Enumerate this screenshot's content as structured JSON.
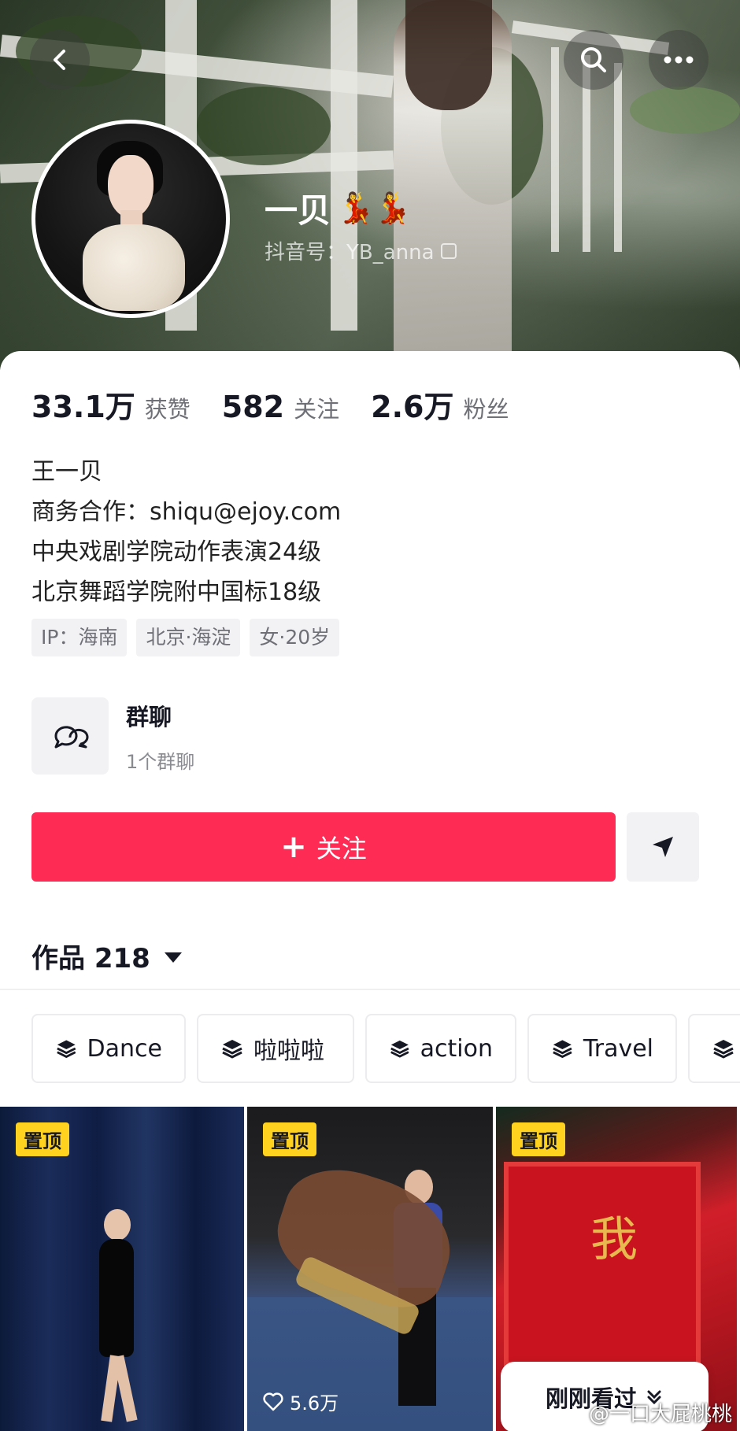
{
  "header": {
    "name": "一贝",
    "name_emoji": "💃💃",
    "handle": "抖音号：YB_anna",
    "back_icon": "chevron-left-icon",
    "search_icon": "search-icon",
    "more_icon": "more-dots-icon"
  },
  "stats": [
    {
      "value": "33.1万",
      "label": "获赞"
    },
    {
      "value": "582",
      "label": "关注"
    },
    {
      "value": "2.6万",
      "label": "粉丝"
    }
  ],
  "bio": {
    "line1": "王一贝",
    "line2": "商务合作：shiqu@ejoy.com",
    "line3": "中央戏剧学院动作表演24级",
    "line4": "北京舞蹈学院附中国标18级"
  },
  "tags": [
    "IP：海南",
    "北京·海淀",
    "女·20岁"
  ],
  "group_chat": {
    "title": "群聊",
    "subtitle": "1个群聊"
  },
  "actions": {
    "follow_label": "关注",
    "follow_color": "#fe2c55"
  },
  "works": {
    "label": "作品 218"
  },
  "collections": [
    "Dance",
    "啦啦啦",
    "action",
    "Travel",
    ""
  ],
  "videos": [
    {
      "pinned": "置顶",
      "likes": ""
    },
    {
      "pinned": "置顶",
      "likes": "5.6万"
    },
    {
      "pinned": "置顶",
      "likes": ""
    }
  ],
  "recently_viewed": "刚刚看过",
  "watermark": "@一口大屁桃桃"
}
